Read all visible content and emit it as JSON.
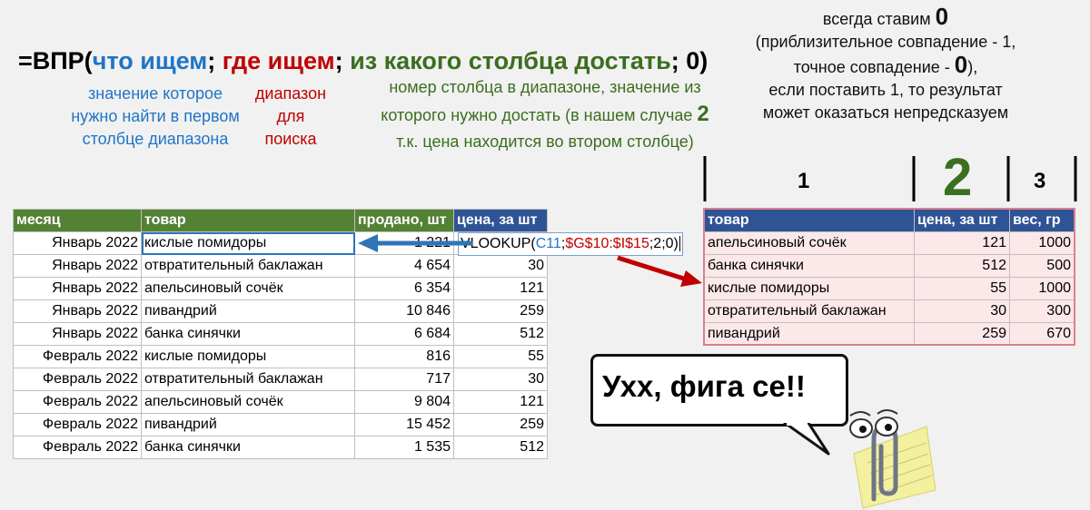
{
  "formula": {
    "prefix": "=ВПР(",
    "what": "что ищем",
    "sep1": "; ",
    "where": "где ищем",
    "sep2": "; ",
    "which_col": "из какого столбца достать",
    "suffix": "; 0)"
  },
  "notes": {
    "blue": [
      "значение которое",
      "нужно найти в первом",
      "столбце диапазона"
    ],
    "red": [
      "диапазон",
      "для",
      "поиска"
    ],
    "green_line1": "номер столбца в диапазоне, значение из",
    "green_line2_pre": "которого нужно достать (в нашем случае ",
    "green_line2_big": "2",
    "green_line3": "т.к. цена находится во втором столбце)",
    "right_line1_pre": "всегда ставим ",
    "right_line1_big": "0",
    "right_line2": "(приблизительное совпадение - 1,",
    "right_line3_pre": "точное совпадение - ",
    "right_line3_big": "0",
    "right_line3_post": "),",
    "right_line4": "если поставить 1, то результат",
    "right_line5": "может оказаться непредсказуем"
  },
  "left_table": {
    "headers": [
      "месяц",
      "товар",
      "продано, шт",
      "цена, за шт"
    ],
    "rows": [
      [
        "Январь 2022",
        "кислые помидоры",
        "1 221",
        ""
      ],
      [
        "Январь 2022",
        "отвратительный баклажан",
        "4 654",
        "30"
      ],
      [
        "Январь 2022",
        "апельсиновый сочёк",
        "6 354",
        "121"
      ],
      [
        "Январь 2022",
        "пивандрий",
        "10 846",
        "259"
      ],
      [
        "Январь 2022",
        "банка синячки",
        "6 684",
        "512"
      ],
      [
        "Февраль 2022",
        "кислые помидоры",
        "816",
        "55"
      ],
      [
        "Февраль 2022",
        "отвратительный баклажан",
        "717",
        "30"
      ],
      [
        "Февраль 2022",
        "апельсиновый сочёк",
        "9 804",
        "121"
      ],
      [
        "Февраль 2022",
        "пивандрий",
        "15 452",
        "259"
      ],
      [
        "Февраль 2022",
        "банка синячки",
        "1 535",
        "512"
      ]
    ]
  },
  "formula_cell": {
    "fn": "VLOOKUP(",
    "arg1": "C11",
    "sep1": ";",
    "arg2": "$G$10:$I$15",
    "rest": ";2;0)"
  },
  "column_numbers": [
    "1",
    "2",
    "3"
  ],
  "right_table": {
    "headers": [
      "товар",
      "цена, за шт",
      "вес, гр"
    ],
    "rows": [
      [
        "апельсиновый сочёк",
        "121",
        "1000"
      ],
      [
        "банка синячки",
        "512",
        "500"
      ],
      [
        "кислые помидоры",
        "55",
        "1000"
      ],
      [
        "отвратительный баклажан",
        "30",
        "300"
      ],
      [
        "пивандрий",
        "259",
        "670"
      ]
    ]
  },
  "bubble_text": "Ухх, фига се!!",
  "colors": {
    "blue": "#1f75c6",
    "red": "#c00000",
    "green": "#3b6e1e",
    "header_green": "#548235",
    "header_blue": "#2f5496",
    "pink_row": "#fce8e8"
  },
  "icons": [
    "blue-arrow-icon",
    "red-arrow-icon",
    "paperclip-assistant-icon"
  ]
}
